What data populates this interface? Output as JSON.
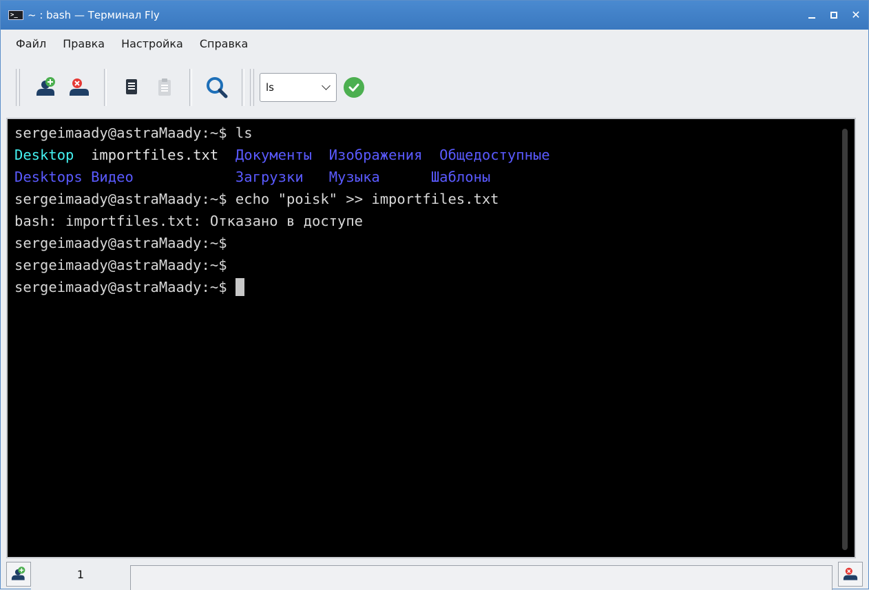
{
  "window": {
    "title": "~ : bash — Терминал Fly",
    "icon_glyph": ">_"
  },
  "menu": {
    "items": [
      "Файл",
      "Правка",
      "Настройка",
      "Справка"
    ]
  },
  "toolbar": {
    "icons": [
      "new-tab-icon",
      "close-tab-icon",
      "copy-icon",
      "paste-icon",
      "search-icon",
      "run-icon"
    ],
    "command_combo": {
      "value": "ls"
    }
  },
  "terminal": {
    "prompt": "sergeimaady@astraMaady:~$",
    "lines": [
      {
        "prompt": "sergeimaady@astraMaady:~$",
        "cmd": " ls"
      },
      {
        "ls_row": [
          {
            "text": "Desktop",
            "color": "cyan",
            "pad": "  "
          },
          {
            "text": "importfiles.txt",
            "color": "white",
            "pad": "  "
          },
          {
            "text": "Документы",
            "color": "blue",
            "pad": "  "
          },
          {
            "text": "Изображения",
            "color": "blue",
            "pad": "  "
          },
          {
            "text": "Общедоступные",
            "color": "blue",
            "pad": ""
          }
        ]
      },
      {
        "ls_row": [
          {
            "text": "Desktops",
            "color": "blue",
            "pad": " "
          },
          {
            "text": "Видео",
            "color": "blue",
            "pad": "            "
          },
          {
            "text": "Загрузки",
            "color": "blue",
            "pad": "   "
          },
          {
            "text": "Музыка",
            "color": "blue",
            "pad": "      "
          },
          {
            "text": "Шаблоны",
            "color": "blue",
            "pad": ""
          }
        ]
      },
      {
        "prompt": "sergeimaady@astraMaady:~$",
        "cmd": " echo \"poisk\" >> importfiles.txt"
      },
      {
        "plain": "bash: importfiles.txt: Отказано в доступе"
      },
      {
        "prompt": "sergeimaady@astraMaady:~$",
        "cmd": ""
      },
      {
        "prompt": "sergeimaady@astraMaady:~$",
        "cmd": ""
      },
      {
        "prompt": "sergeimaady@astraMaady:~$",
        "cmd": " ",
        "cursor": true
      }
    ]
  },
  "tabs": {
    "items": [
      {
        "label": "1"
      }
    ]
  },
  "colors": {
    "cyan": "#44f2f2",
    "blue": "#5a5aff",
    "white": "#e4e4e4",
    "titlebar": "#3f80c6"
  }
}
